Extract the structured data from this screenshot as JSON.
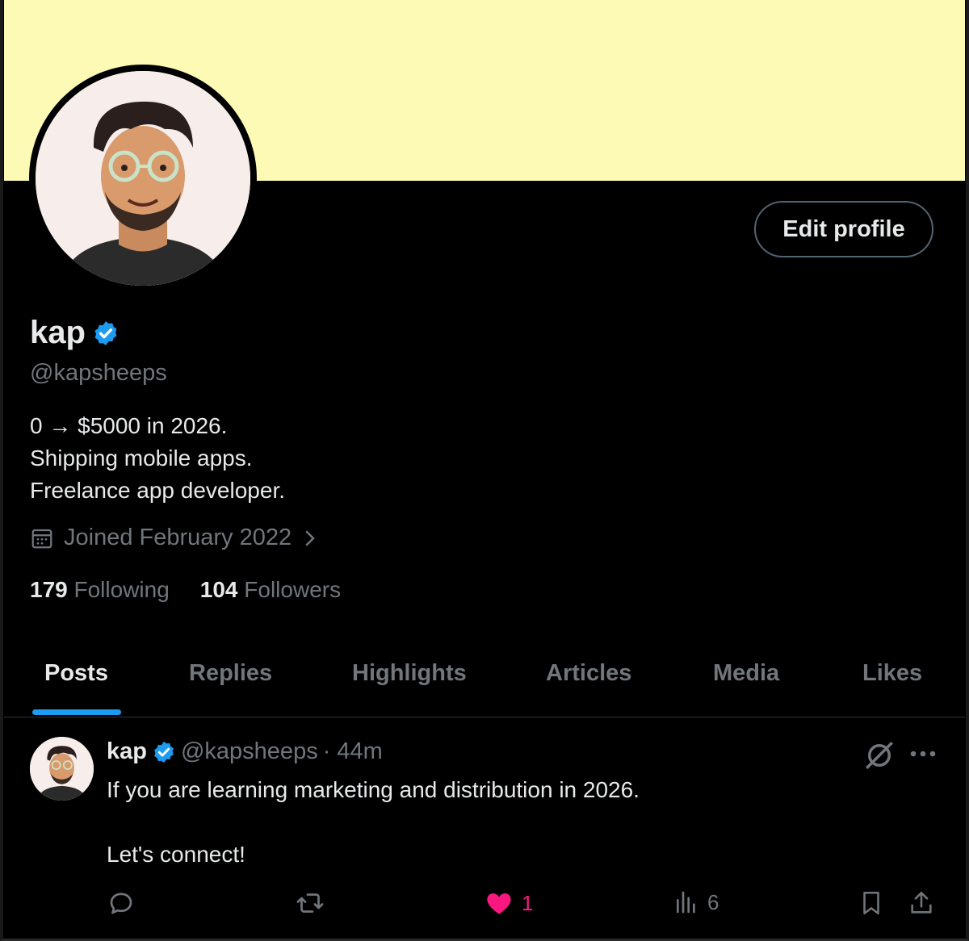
{
  "profile": {
    "display_name": "kap",
    "handle": "@kapsheeps",
    "bio": [
      "0 → $5000 in 2026.",
      "Shipping mobile apps.",
      "Freelance app developer."
    ],
    "joined": "Joined February 2022",
    "following_count": "179",
    "following_label": "Following",
    "followers_count": "104",
    "followers_label": "Followers",
    "edit_button": "Edit profile"
  },
  "tabs": [
    {
      "label": "Posts",
      "active": true
    },
    {
      "label": "Replies"
    },
    {
      "label": "Highlights"
    },
    {
      "label": "Articles"
    },
    {
      "label": "Media"
    },
    {
      "label": "Likes"
    }
  ],
  "post": {
    "author": "kap",
    "handle": "@kapsheeps",
    "time": "· 44m",
    "lines": [
      "If you are learning marketing and distribution in 2026.",
      "",
      "Let's connect!"
    ],
    "likes": "1",
    "views": "6"
  },
  "colors": {
    "banner": "#fdfab5",
    "accent": "#1d9bf0",
    "like": "#f91880",
    "muted": "#71767b",
    "text": "#e7e9ea",
    "background": "#000000"
  },
  "icons": [
    "verified-badge-icon",
    "calendar-icon",
    "chevron-right-icon",
    "grok-icon",
    "more-icon",
    "reply-icon",
    "repost-icon",
    "heart-icon",
    "views-icon",
    "bookmark-icon",
    "share-icon"
  ]
}
